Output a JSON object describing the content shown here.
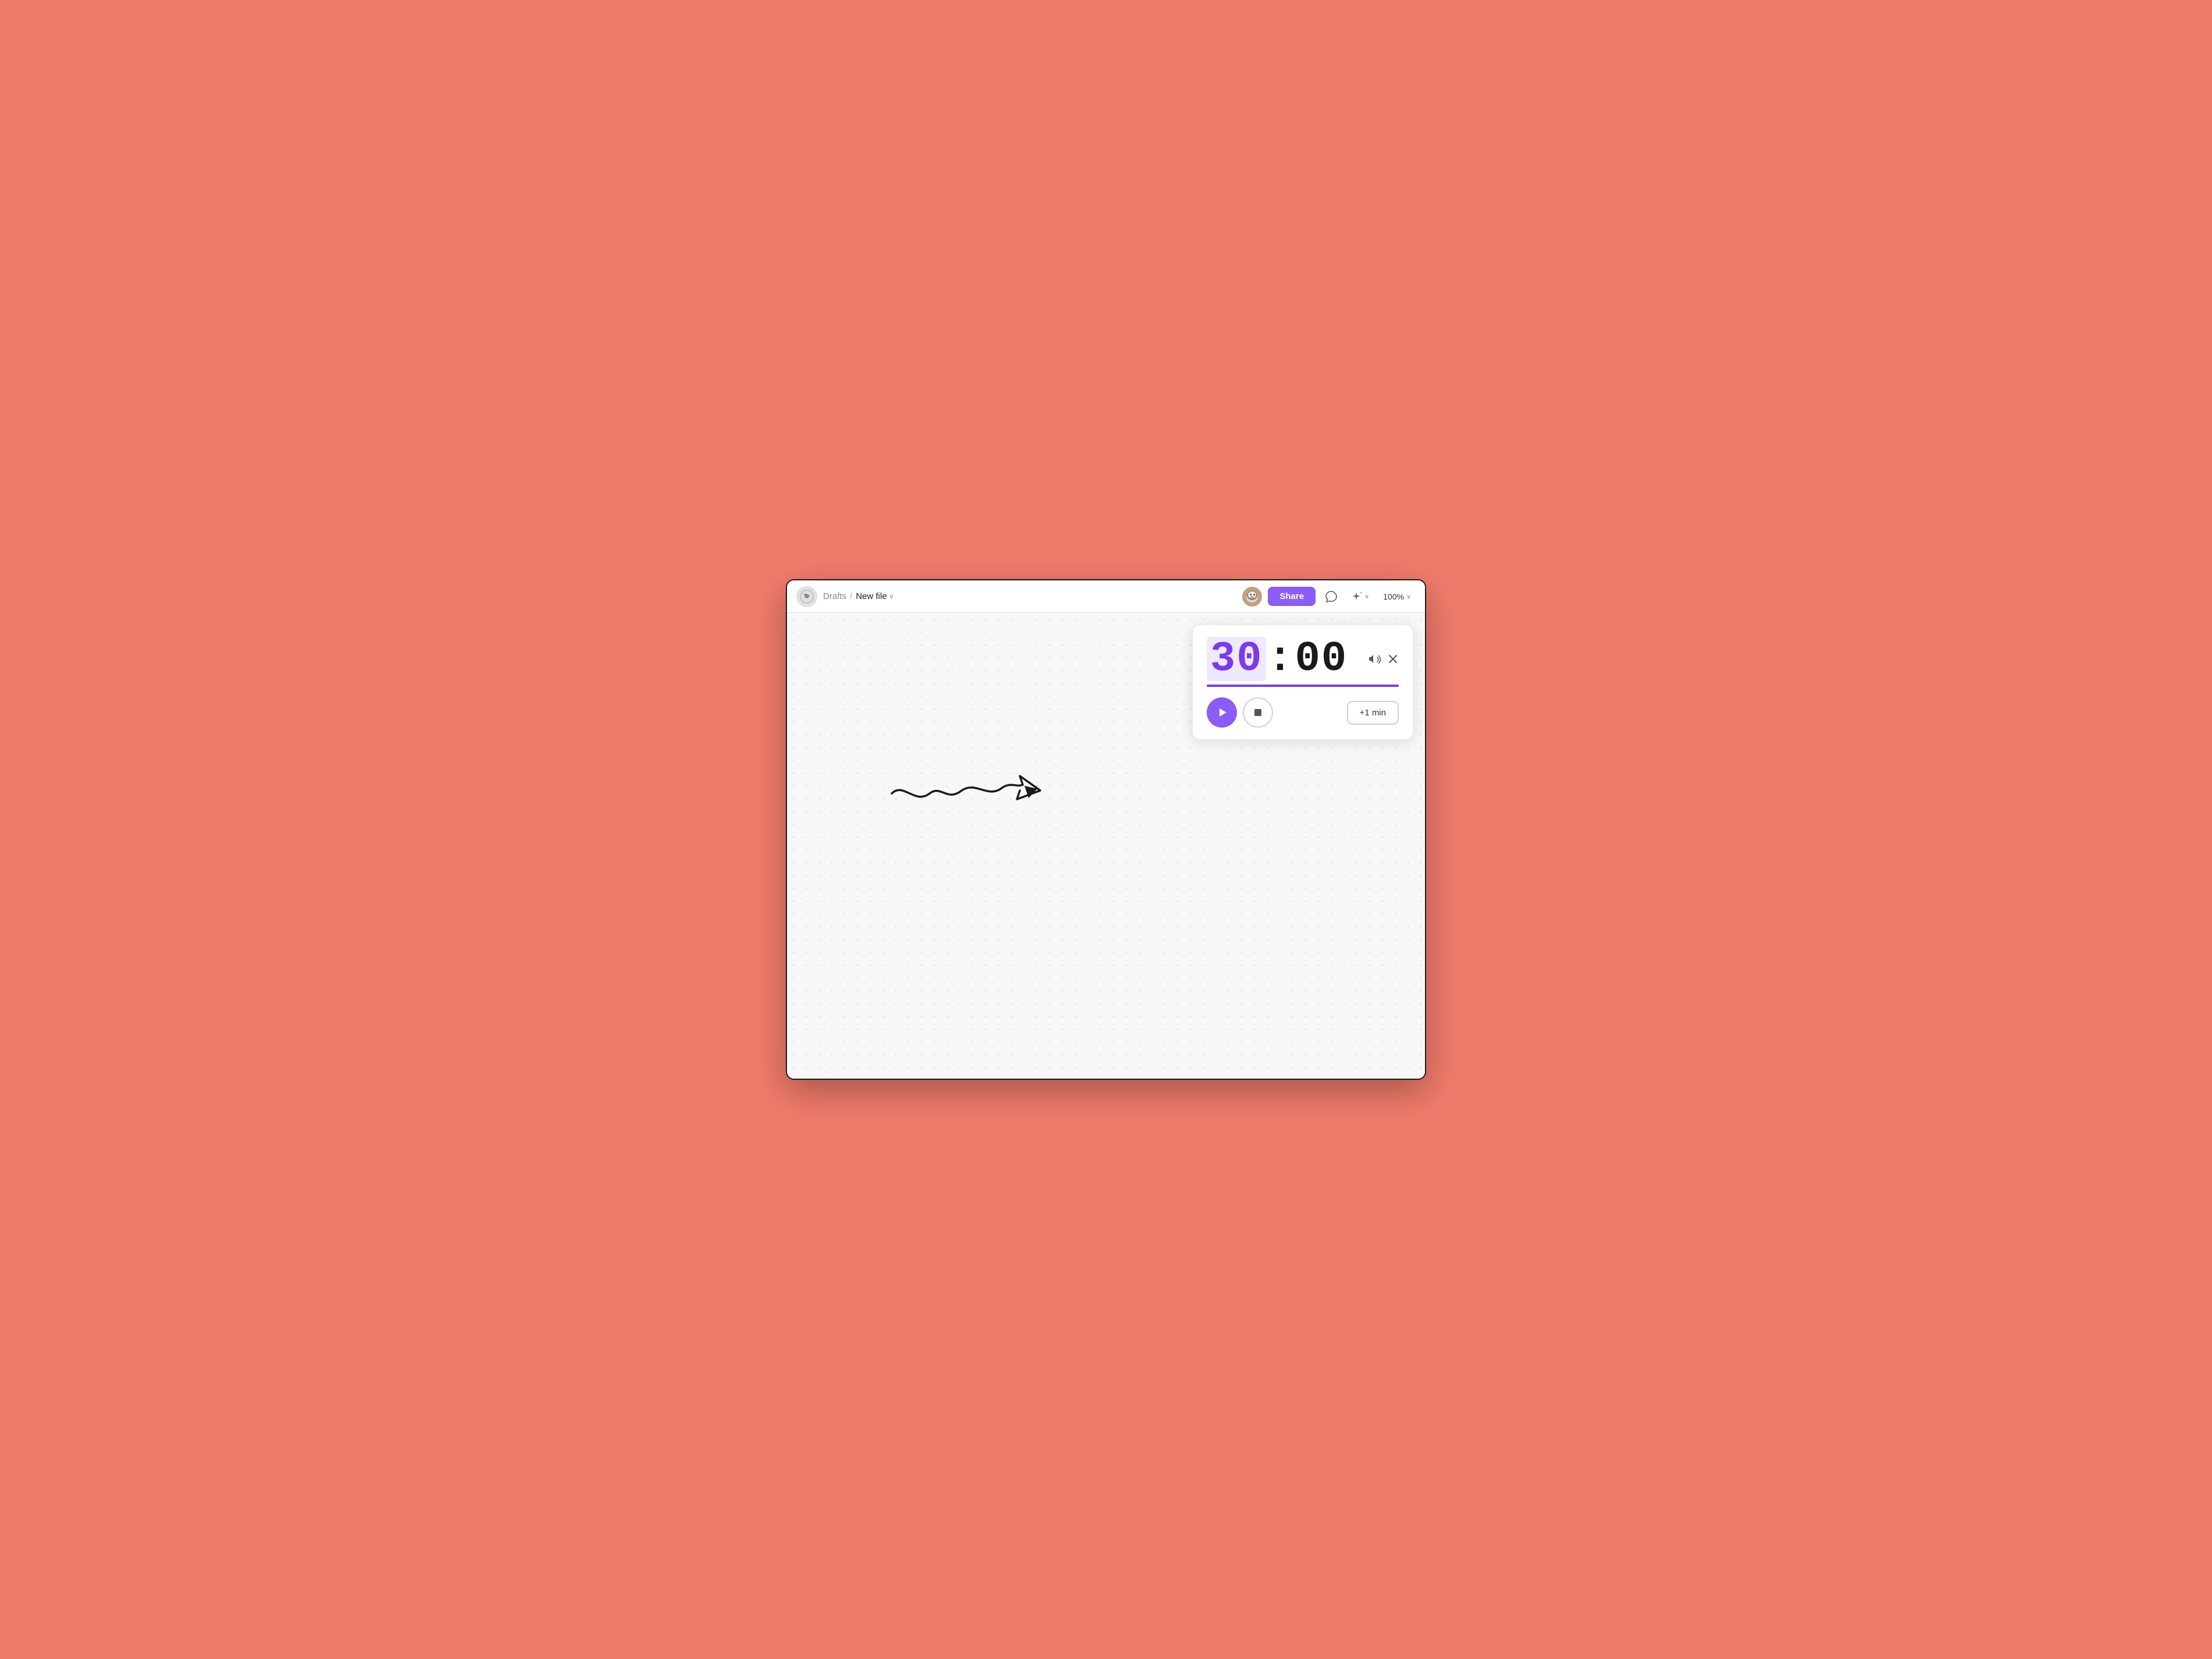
{
  "app": {
    "title": "New file"
  },
  "toolbar": {
    "logo_icon": "🌿",
    "breadcrumb_drafts": "Drafts",
    "breadcrumb_separator": "/",
    "breadcrumb_filename": "New file",
    "share_label": "Share",
    "zoom_level": "100%",
    "ai_label": "AI",
    "comment_icon": "💬",
    "sparkle_icon": "✦",
    "chevron_down": "∨",
    "user_avatar": "🐕"
  },
  "timer": {
    "minutes_highlight": "30",
    "colon": ":",
    "seconds": "00",
    "sound_icon": "🔊",
    "close_icon": "✕",
    "play_icon": "▶",
    "stop_icon": "■",
    "plus_min_label": "+1 min",
    "progress_percent": 100
  },
  "canvas": {
    "dot_color": "#cccccc"
  }
}
